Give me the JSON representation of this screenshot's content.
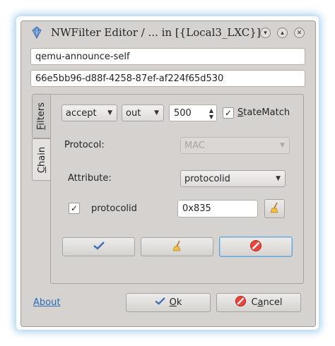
{
  "window": {
    "title": "NWFilter Editor / ... in [{Local3_LXC}]"
  },
  "fields": {
    "name": "qemu-announce-self",
    "uuid": "66e5bb96-d88f-4258-87ef-af224f65d530"
  },
  "tabs": [
    {
      "label": "Filters",
      "mnemonic": "F"
    },
    {
      "label": "Chain",
      "mnemonic": "C"
    }
  ],
  "rule": {
    "action": "accept",
    "direction": "out",
    "priority": "500",
    "statematch_label": "StateMatch",
    "statematch_checked": true,
    "protocol_label": "Protocol:",
    "protocol_value": "MAC",
    "attribute_label": "Attribute:",
    "attribute_value": "protocolid",
    "attr_enabled_label": "protocolid",
    "attr_enabled_checked": true,
    "attr_value": "0x835"
  },
  "footer": {
    "about": "About",
    "ok": "Ok",
    "cancel": "Cancel"
  }
}
